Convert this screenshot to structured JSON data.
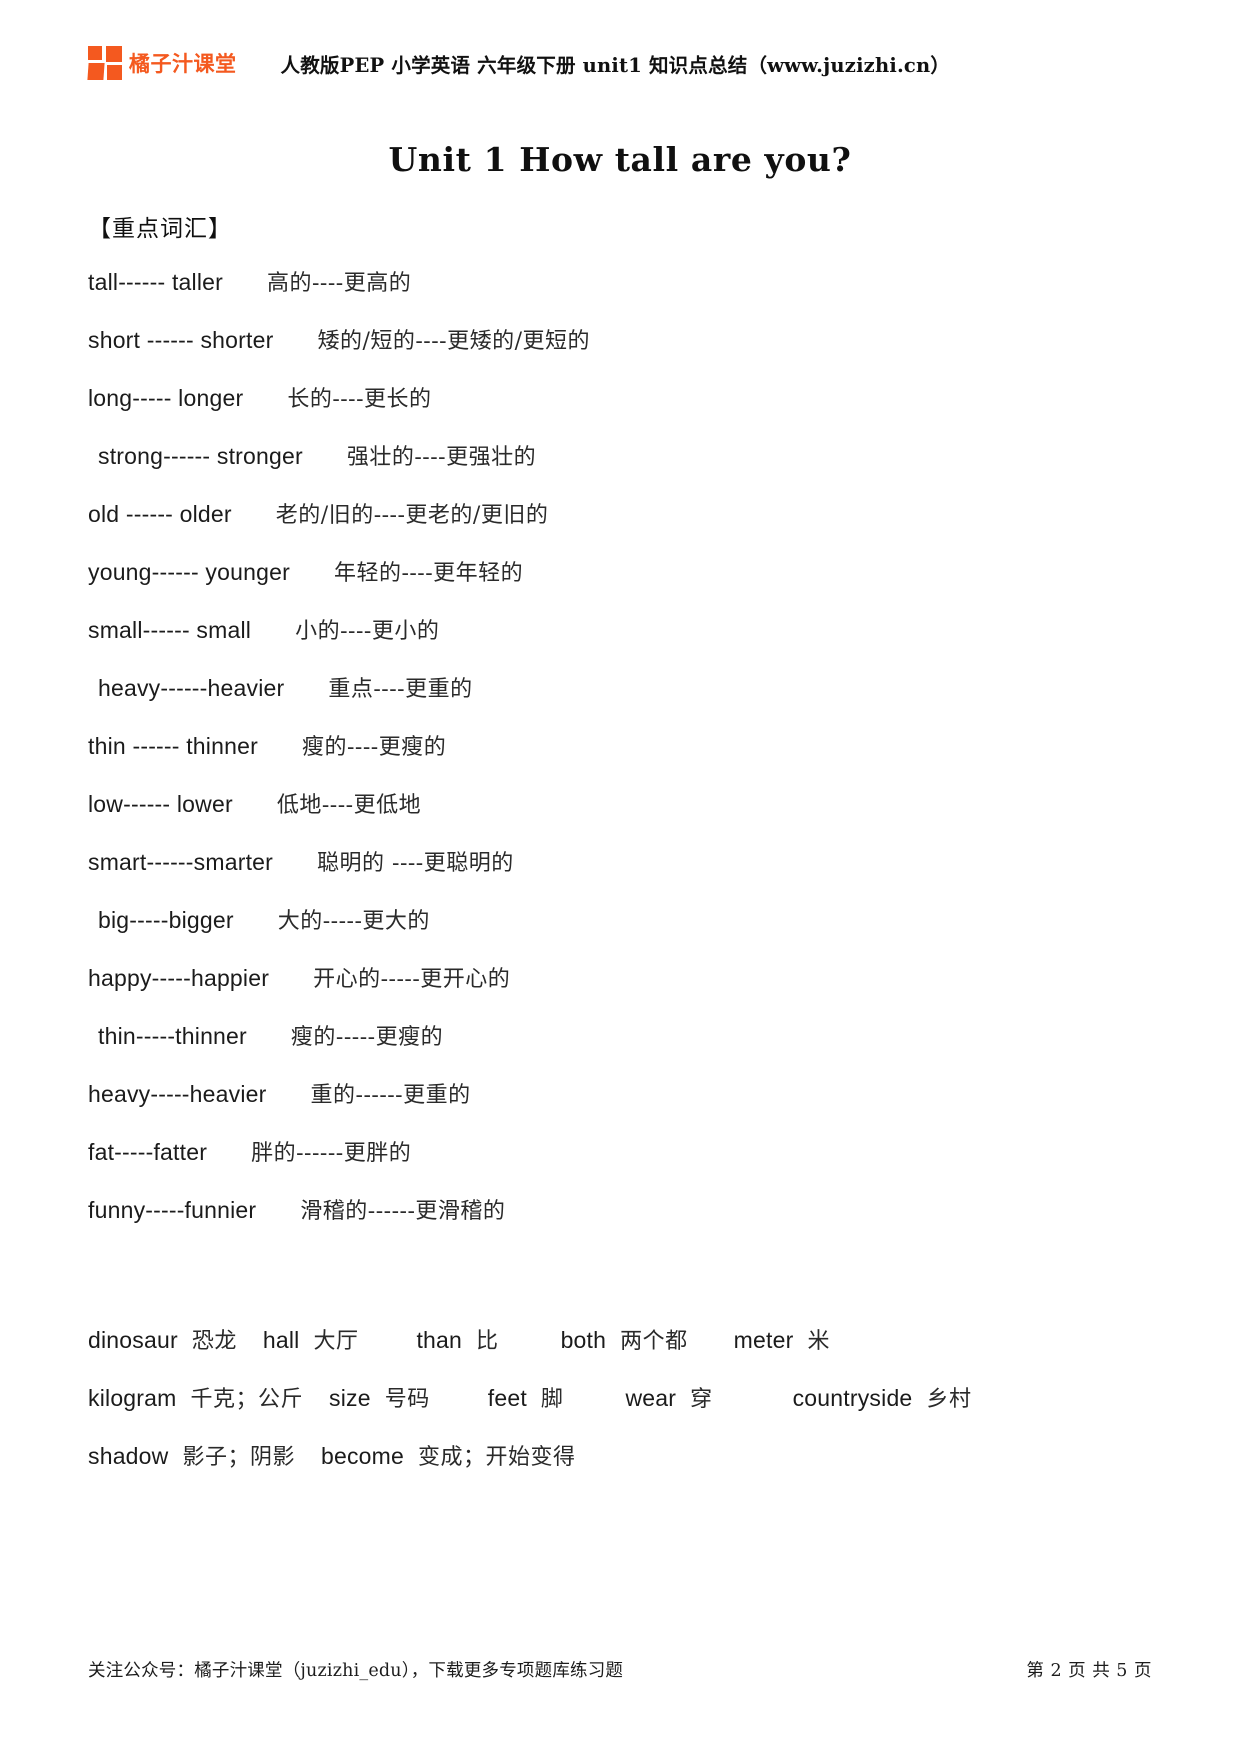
{
  "header": {
    "logo_text": "橘子汁课堂",
    "logo_color": "#f4591f",
    "title": "人教版PEP 小学英语 六年级下册  unit1 知识点总结（www.juzizhi.cn）"
  },
  "doc_title": "Unit 1 How tall are you?",
  "sections": {
    "vocabulary_heading": "【重点词汇】"
  },
  "vocabulary": [
    {
      "indent": false,
      "en": "tall------   taller",
      "cn": "高的----更高的"
    },
    {
      "indent": false,
      "en": "short ------   shorter",
      "cn": "矮的/短的----更矮的/更短的"
    },
    {
      "indent": false,
      "en": "long----- longer",
      "cn": "长的----更长的"
    },
    {
      "indent": true,
      "en": "strong------ stronger",
      "cn": "强壮的----更强壮的"
    },
    {
      "indent": false,
      "en": "old  ------ older",
      "cn": "老的/旧的----更老的/更旧的"
    },
    {
      "indent": false,
      "en": "young------ younger",
      "cn": "年轻的----更年轻的"
    },
    {
      "indent": false,
      "en": "small------ small",
      "cn": "小的----更小的"
    },
    {
      "indent": true,
      "en": "heavy------heavier",
      "cn": "重点----更重的"
    },
    {
      "indent": false,
      "en": "thin ------ thinner",
      "cn": "瘦的----更瘦的"
    },
    {
      "indent": false,
      "en": "low------ lower",
      "cn": "低地----更低地"
    },
    {
      "indent": false,
      "en": "smart------smarter",
      "cn": "聪明的 ----更聪明的"
    },
    {
      "indent": true,
      "en": "big-----bigger",
      "cn": "大的-----更大的"
    },
    {
      "indent": false,
      "en": "happy-----happier",
      "cn": "开心的-----更开心的"
    },
    {
      "indent": true,
      "en": "thin-----thinner",
      "cn": "瘦的-----更瘦的"
    },
    {
      "indent": false,
      "en": "heavy-----heavier",
      "cn": "重的------更重的"
    },
    {
      "indent": false,
      "en": "fat-----fatter",
      "cn": "胖的------更胖的"
    },
    {
      "indent": false,
      "en": "funny-----funnier",
      "cn": "滑稽的------更滑稽的"
    }
  ],
  "glossary": [
    [
      {
        "en": "dinosaur",
        "cn": "恐龙"
      },
      {
        "en": "hall",
        "cn": "大厅"
      },
      {
        "en": "than",
        "cn": "比"
      },
      {
        "en": "both",
        "cn": "两个都"
      },
      {
        "en": "meter",
        "cn": "米"
      }
    ],
    [
      {
        "en": "kilogram",
        "cn": "千克；公斤"
      },
      {
        "en": "size",
        "cn": "号码"
      },
      {
        "en": "feet",
        "cn": "脚"
      },
      {
        "en": "wear",
        "cn": "穿"
      },
      {
        "en": "countryside",
        "cn": "乡村"
      }
    ],
    [
      {
        "en": "shadow",
        "cn": "影子；阴影"
      },
      {
        "en": "become",
        "cn": "变成；开始变得"
      }
    ]
  ],
  "footer": {
    "note": "关注公众号：橘子汁课堂（juzizhi_edu），下载更多专项题库练习题",
    "page": "第 2 页 共 5 页"
  }
}
